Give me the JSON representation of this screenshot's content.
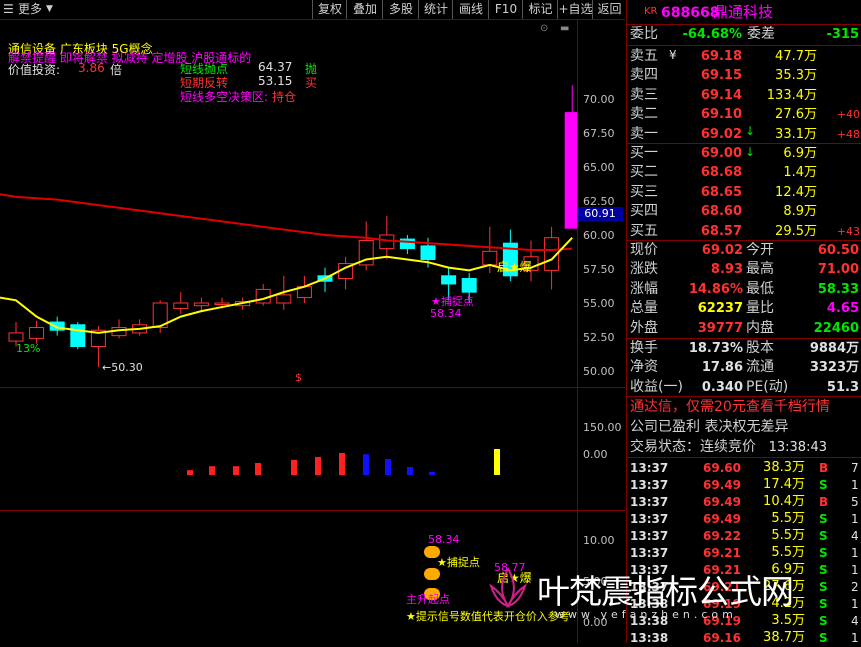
{
  "toolbar": {
    "left1": "",
    "left2": "更多",
    "buttons": [
      "复权",
      "叠加",
      "多股",
      "统计",
      "画线",
      "F10",
      "标记",
      "+自选",
      "返回"
    ]
  },
  "stock": {
    "prefix": "KR",
    "code": "688668",
    "name": "鼎通科技"
  },
  "indicator_text": {
    "line1": "通信设备   广东板块   5G概念",
    "line2": "解禁提醒 即将解禁 拟减持 定增股 沪股通标的",
    "line3_label": "价值投资:",
    "line3_value": "3.86",
    "line3_unit": "倍",
    "short_point_label": "短线抛点",
    "short_point_value": "64.37",
    "short_point_tag": "抛",
    "short_turn_label": "短期反转",
    "short_turn_value": "53.15",
    "short_turn_tag": "买",
    "zone_label": "短线多空决策区:",
    "zone_value": "持仓"
  },
  "price_axis": [
    "70.00",
    "67.50",
    "65.00",
    "62.50",
    "60.00",
    "57.50",
    "55.00",
    "52.50",
    "50.00"
  ],
  "current_price_tag": "60.91",
  "annotations": {
    "pct13": "13%",
    "low": "←50.30",
    "qibao": "启★爆",
    "buzhuo": "★捕捉点",
    "buzhuo_val": "58.34",
    "dollar": "$"
  },
  "volume_axis": [
    "150.00",
    "0.00"
  ],
  "sub_axis": [
    "10.00",
    "5.00",
    "0.00"
  ],
  "sub_annotations": {
    "v1": "58.34",
    "buzhuo": "★捕捉点",
    "qibao": "启★爆",
    "v2": "58.77",
    "main_label": "主升起点",
    "bottom": "★提示信号数值代表开仓价入参考"
  },
  "chart_data": {
    "type": "candlestick",
    "price_ylim": [
      49,
      72
    ],
    "candles": [
      {
        "o": 52.2,
        "c": 52.8,
        "h": 53.6,
        "l": 51.8
      },
      {
        "o": 52.4,
        "c": 53.2,
        "h": 53.7,
        "l": 52.0
      },
      {
        "o": 53.6,
        "c": 53.0,
        "h": 54.0,
        "l": 52.6
      },
      {
        "o": 53.4,
        "c": 51.8,
        "h": 53.6,
        "l": 51.6
      },
      {
        "o": 51.8,
        "c": 53.0,
        "h": 53.3,
        "l": 50.3
      },
      {
        "o": 52.6,
        "c": 53.2,
        "h": 53.8,
        "l": 52.4
      },
      {
        "o": 52.8,
        "c": 53.4,
        "h": 53.8,
        "l": 52.6
      },
      {
        "o": 53.2,
        "c": 55.0,
        "h": 55.2,
        "l": 52.8
      },
      {
        "o": 54.6,
        "c": 55.0,
        "h": 55.8,
        "l": 54.2
      },
      {
        "o": 54.8,
        "c": 55.0,
        "h": 55.4,
        "l": 54.4
      },
      {
        "o": 54.9,
        "c": 55.0,
        "h": 55.4,
        "l": 54.6
      },
      {
        "o": 54.8,
        "c": 55.1,
        "h": 55.4,
        "l": 54.5
      },
      {
        "o": 55.0,
        "c": 56.0,
        "h": 56.4,
        "l": 54.8
      },
      {
        "o": 55.0,
        "c": 55.6,
        "h": 57.0,
        "l": 54.5
      },
      {
        "o": 55.4,
        "c": 56.2,
        "h": 57.0,
        "l": 55.0
      },
      {
        "o": 57.0,
        "c": 56.6,
        "h": 57.6,
        "l": 55.8
      },
      {
        "o": 56.8,
        "c": 57.9,
        "h": 58.4,
        "l": 56.0
      },
      {
        "o": 57.8,
        "c": 59.6,
        "h": 61.0,
        "l": 57.4
      },
      {
        "o": 59.0,
        "c": 60.0,
        "h": 61.4,
        "l": 58.2
      },
      {
        "o": 59.7,
        "c": 59.0,
        "h": 60.0,
        "l": 58.6
      },
      {
        "o": 59.2,
        "c": 58.2,
        "h": 59.8,
        "l": 57.6
      },
      {
        "o": 57.0,
        "c": 56.4,
        "h": 57.6,
        "l": 55.2
      },
      {
        "o": 56.8,
        "c": 55.8,
        "h": 57.2,
        "l": 55.0
      },
      {
        "o": 57.8,
        "c": 58.8,
        "h": 60.6,
        "l": 57.2
      },
      {
        "o": 59.4,
        "c": 57.0,
        "h": 60.4,
        "l": 56.6
      },
      {
        "o": 57.4,
        "c": 58.4,
        "h": 59.6,
        "l": 56.6
      },
      {
        "o": 57.4,
        "c": 59.8,
        "h": 60.6,
        "l": 56.0
      },
      {
        "o": 60.5,
        "c": 69.0,
        "h": 71.0,
        "l": 60.5
      }
    ],
    "ma_red": [
      62.8,
      62.7,
      62.6,
      62.4,
      62.2,
      62.0,
      61.8,
      61.6,
      61.4,
      61.2,
      61.0,
      60.8,
      60.6,
      60.4,
      60.2,
      60.0,
      59.9,
      59.8,
      59.6,
      59.5,
      59.4,
      59.3,
      59.2,
      59.1,
      59.0,
      58.9,
      58.9,
      59.0
    ],
    "ma_yellow": [
      55.2,
      54.0,
      53.2,
      53.0,
      52.8,
      53.0,
      53.1,
      53.3,
      54.0,
      54.4,
      54.7,
      55.0,
      55.3,
      55.8,
      56.2,
      56.8,
      57.6,
      58.2,
      58.4,
      58.2,
      58.0,
      57.6,
      57.4,
      57.8,
      57.4,
      57.6,
      58.2,
      59.8
    ],
    "volumes": [
      0,
      0,
      0,
      0,
      0,
      0,
      0,
      0,
      0,
      0,
      0,
      0,
      0,
      0,
      0,
      0,
      0,
      0,
      0,
      0,
      0,
      0,
      0,
      0,
      0,
      0,
      0,
      120
    ],
    "vol_bars": [
      {
        "i": 8,
        "v": 12,
        "c": "red"
      },
      {
        "i": 9,
        "v": 22,
        "c": "red"
      },
      {
        "i": 10,
        "v": 22,
        "c": "red"
      },
      {
        "i": 11,
        "v": 30,
        "c": "red"
      },
      {
        "i": 12,
        "v": 38,
        "c": "red"
      },
      {
        "i": 13,
        "v": 45,
        "c": "red"
      },
      {
        "i": 14,
        "v": 55,
        "c": "red"
      },
      {
        "i": 15,
        "v": 52,
        "c": "blue"
      },
      {
        "i": 16,
        "v": 40,
        "c": "blue"
      },
      {
        "i": 17,
        "v": 20,
        "c": "blue"
      },
      {
        "i": 18,
        "v": 8,
        "c": "blue"
      },
      {
        "i": 20,
        "v": 65,
        "c": "yellow"
      }
    ],
    "vol_ylim": [
      0,
      200
    ]
  },
  "panel": {
    "weibi_label": "委比",
    "weibi_value": "-64.68%",
    "weicha_label": "委差",
    "weicha_value": "-315",
    "asks": [
      {
        "label": "卖五",
        "price": "69.18",
        "vol": "47.7万",
        "delta": ""
      },
      {
        "label": "卖四",
        "price": "69.15",
        "vol": "35.3万",
        "delta": ""
      },
      {
        "label": "卖三",
        "price": "69.14",
        "vol": "133.4万",
        "delta": ""
      },
      {
        "label": "卖二",
        "price": "69.10",
        "vol": "27.6万",
        "delta": "+40"
      },
      {
        "label": "卖一",
        "price": "69.02",
        "vol": "33.1万",
        "delta": "+48"
      }
    ],
    "bids": [
      {
        "label": "买一",
        "price": "69.00",
        "vol": "6.9万",
        "delta": ""
      },
      {
        "label": "买二",
        "price": "68.68",
        "vol": "1.4万",
        "delta": ""
      },
      {
        "label": "买三",
        "price": "68.65",
        "vol": "12.4万",
        "delta": ""
      },
      {
        "label": "买四",
        "price": "68.60",
        "vol": "8.9万",
        "delta": ""
      },
      {
        "label": "买五",
        "price": "68.57",
        "vol": "29.5万",
        "delta": "+43"
      }
    ],
    "stats": [
      {
        "l1": "现价",
        "v1": "69.02",
        "c1": "red",
        "l2": "今开",
        "v2": "60.50",
        "c2": "red"
      },
      {
        "l1": "涨跌",
        "v1": "8.93",
        "c1": "red",
        "l2": "最高",
        "v2": "71.00",
        "c2": "red"
      },
      {
        "l1": "涨幅",
        "v1": "14.86%",
        "c1": "red",
        "l2": "最低",
        "v2": "58.33",
        "c2": "green"
      },
      {
        "l1": "总量",
        "v1": "62237",
        "c1": "yellow",
        "l2": "量比",
        "v2": "4.65",
        "c2": "magenta"
      },
      {
        "l1": "外盘",
        "v1": "39777",
        "c1": "red",
        "l2": "内盘",
        "v2": "22460",
        "c2": "green"
      }
    ],
    "stats2": [
      {
        "l1": "换手",
        "v1": "18.73%",
        "c1": "white",
        "l2": "股本",
        "v2": "9884万",
        "c2": "white"
      },
      {
        "l1": "净资",
        "v1": "17.86",
        "c1": "white",
        "l2": "流通",
        "v2": "3323万",
        "c2": "white"
      },
      {
        "l1": "收益(一)",
        "v1": "0.340",
        "c1": "white",
        "l2": "PE(动)",
        "v2": "51.3",
        "c2": "white"
      }
    ],
    "promo": "通达信，仅需20元查看千档行情",
    "profit": "公司已盈利 表决权无差异",
    "status_label": "交易状态：连续竞价",
    "status_time": "13:38:43",
    "trades": [
      {
        "t": "13:37",
        "p": "69.60",
        "v": "38.3万",
        "s": "B"
      },
      {
        "t": "13:37",
        "p": "69.49",
        "v": "17.4万",
        "s": "S"
      },
      {
        "t": "13:37",
        "p": "69.49",
        "v": "10.4万",
        "s": "B"
      },
      {
        "t": "13:37",
        "p": "69.49",
        "v": "5.5万",
        "s": "S"
      },
      {
        "t": "13:37",
        "p": "69.22",
        "v": "5.5万",
        "s": "S"
      },
      {
        "t": "13:37",
        "p": "69.21",
        "v": "5.5万",
        "s": "S"
      },
      {
        "t": "13:37",
        "p": "69.21",
        "v": "6.9万",
        "s": "S"
      },
      {
        "t": "13:37",
        "p": "69.21",
        "v": "27.6万",
        "s": "S"
      },
      {
        "t": "13:38",
        "p": "69.19",
        "v": "4.2万",
        "s": "S"
      },
      {
        "t": "13:38",
        "p": "69.19",
        "v": "3.5万",
        "s": "S"
      },
      {
        "t": "13:38",
        "p": "69.16",
        "v": "38.7万",
        "s": "S"
      }
    ],
    "trade_extra": [
      "7",
      "1",
      "5",
      "1",
      "4",
      "1",
      "1",
      "2",
      "1",
      "4",
      "1"
    ]
  },
  "watermark": {
    "text": "叶梵震指标公式网",
    "url": "www.yefanzhen.com"
  }
}
